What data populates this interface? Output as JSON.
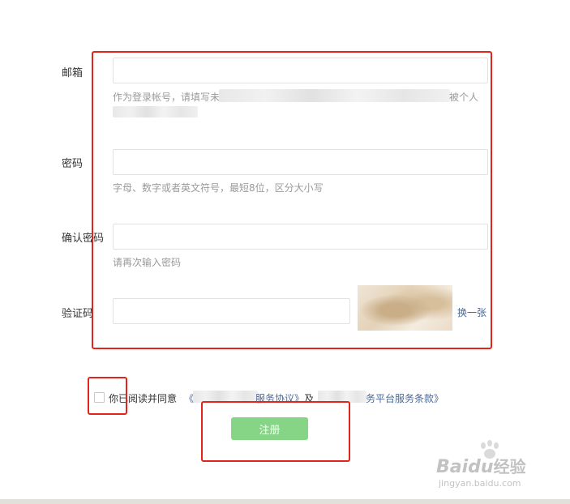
{
  "form": {
    "email": {
      "label": "邮箱",
      "value": "",
      "hint_start": "作为登录帐号，请填写未",
      "hint_end": "被个人"
    },
    "password": {
      "label": "密码",
      "value": "",
      "hint": "字母、数字或者英文符号，最短8位，区分大小写"
    },
    "confirm": {
      "label": "确认密码",
      "value": "",
      "hint": "请再次输入密码"
    },
    "captcha": {
      "label": "验证码",
      "value": "",
      "refresh": "换一张"
    }
  },
  "agreement": {
    "text": "你已阅读并同意",
    "open_quote": "《",
    "link1_tail": "服务协议》",
    "and": "及",
    "link2_tail": "务平台服务条款》"
  },
  "submit_label": "注册",
  "watermark": {
    "brand": "Bai",
    "brand2": "du",
    "suffix": "经验",
    "url": "jingyan.baidu.com"
  },
  "colors": {
    "accent_green": "#86d485",
    "annotation_red": "#e1251b",
    "link": "#4a6896"
  }
}
